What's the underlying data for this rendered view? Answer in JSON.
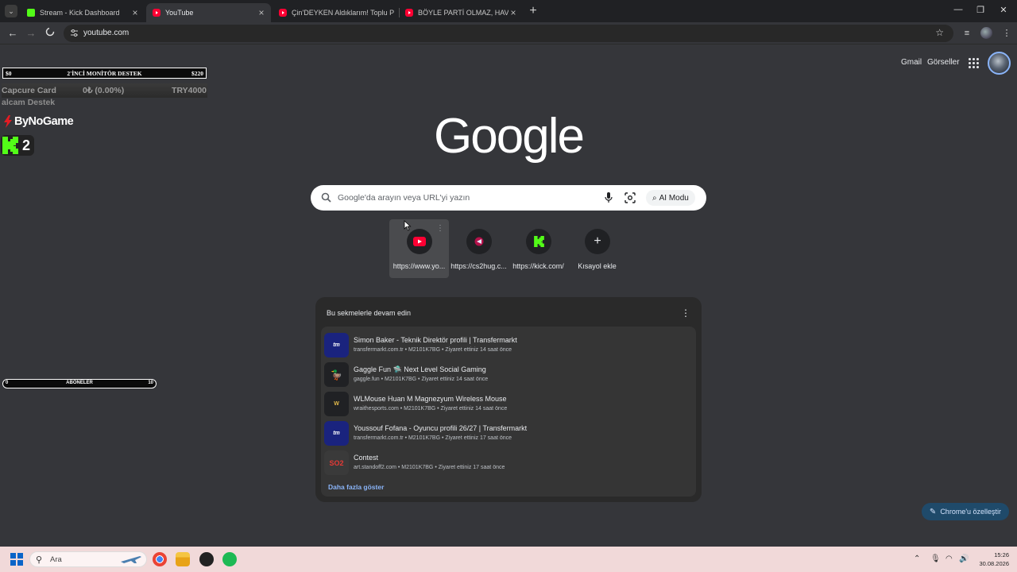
{
  "browser": {
    "tabs": [
      {
        "title": "Stream - Kick Dashboard",
        "favicon": "kick-icon",
        "active": false
      },
      {
        "title": "YouTube",
        "favicon": "youtube-icon",
        "active": true
      },
      {
        "title": "Çin'DEYKEN Aldıklarım! Toplu P",
        "favicon": "youtube-icon",
        "active": false
      },
      {
        "title": "BÖYLE PARTİ OLMAZ, HAVUZA",
        "favicon": "youtube-icon",
        "active": false
      }
    ],
    "address": "youtube.com"
  },
  "overlay": {
    "goal_bar": {
      "left": "$0",
      "title": "2'İNCİ MONİTÖR DESTEK",
      "right": "$220"
    },
    "capture_row": {
      "label": "Capcure Card",
      "progress": "0₺ (0.00%)",
      "goal": "TRY4000"
    },
    "capture_sub": "alcam Destek",
    "sponsor": "ByNoGame",
    "kick_count": "2",
    "subs_bar": {
      "left": "0",
      "title": "ABONELER",
      "right": "10"
    }
  },
  "google": {
    "links": {
      "gmail": "Gmail",
      "images": "Görseller"
    },
    "logo": "Google",
    "search_placeholder": "Google'da arayın veya URL'yi yazın",
    "ai_mode": "AI Modu",
    "shortcuts": [
      {
        "label": "https://www.yo...",
        "icon": "youtube-icon"
      },
      {
        "label": "https://cs2hug.c...",
        "icon": "cs2hug-icon"
      },
      {
        "label": "https://kick.com/",
        "icon": "kick-icon"
      },
      {
        "label": "Kısayol ekle",
        "icon": "plus-icon"
      }
    ],
    "continue_card": {
      "title": "Bu sekmelerle devam edin",
      "items": [
        {
          "title": "Simon Baker - Teknik Direktör profili | Transfermarkt",
          "meta": "transfermarkt.com.tr • M2101K7BG • Ziyaret ettiniz 14 saat önce",
          "icon_text": "tm"
        },
        {
          "title": "Gaggle Fun 🛸 Next Level Social Gaming",
          "meta": "gaggle.fun • M2101K7BG • Ziyaret ettiniz 14 saat önce",
          "icon_text": "🦆"
        },
        {
          "title": "WLMouse Huan M Magnezyum Wireless Mouse",
          "meta": "wraithesports.com • M2101K7BG • Ziyaret ettiniz 14 saat önce",
          "icon_text": "W"
        },
        {
          "title": "Youssouf Fofana - Oyuncu profili 26/27 | Transfermarkt",
          "meta": "transfermarkt.com.tr • M2101K7BG • Ziyaret ettiniz 17 saat önce",
          "icon_text": "tm"
        },
        {
          "title": "Contest",
          "meta": "art.standoff2.com • M2101K7BG • Ziyaret ettiniz 17 saat önce",
          "icon_text": "SO2"
        }
      ],
      "show_more": "Daha fazla göster"
    },
    "customize": "Chrome'u özelleştir"
  },
  "taskbar": {
    "search_placeholder": "Ara",
    "time": "15:26",
    "date": "30.08.2026"
  },
  "colors": {
    "accent": "#8ab4f8",
    "kick": "#53fc18",
    "youtube": "#ff0033"
  }
}
